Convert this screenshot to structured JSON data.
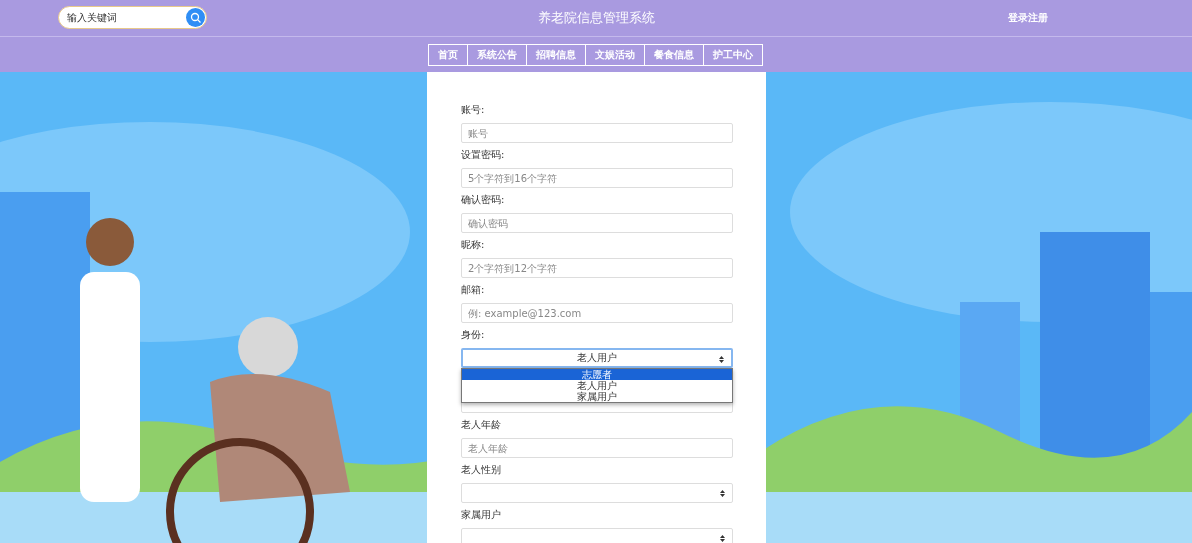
{
  "header": {
    "search": {
      "placeholder": "输入关键词"
    },
    "title": "养老院信息管理系统",
    "login_link": "登录注册"
  },
  "nav": [
    "首页",
    "系统公告",
    "招聘信息",
    "文娱活动",
    "餐食信息",
    "护工中心"
  ],
  "form": [
    {
      "kind": "input",
      "label": "账号:",
      "placeholder": "账号"
    },
    {
      "kind": "input",
      "label": "设置密码:",
      "placeholder": "5个字符到16个字符"
    },
    {
      "kind": "input",
      "label": "确认密码:",
      "placeholder": "确认密码"
    },
    {
      "kind": "input",
      "label": "昵称:",
      "placeholder": "2个字符到12个字符"
    },
    {
      "kind": "input",
      "label": "邮箱:",
      "placeholder": "例: example@123.com"
    },
    {
      "kind": "select",
      "label": "身份:",
      "value": "老人用户",
      "expanded": true,
      "options": [
        {
          "label": "志愿者",
          "highlighted": true
        },
        {
          "label": "老人用户",
          "highlighted": false
        },
        {
          "label": "家属用户",
          "highlighted": false
        }
      ]
    },
    {
      "kind": "input"
    },
    {
      "kind": "input",
      "label": "老人年龄",
      "placeholder": "老人年龄"
    },
    {
      "kind": "select",
      "label": "老人性别",
      "expanded": false
    },
    {
      "kind": "select",
      "label": "家属用户",
      "expanded": false
    }
  ]
}
